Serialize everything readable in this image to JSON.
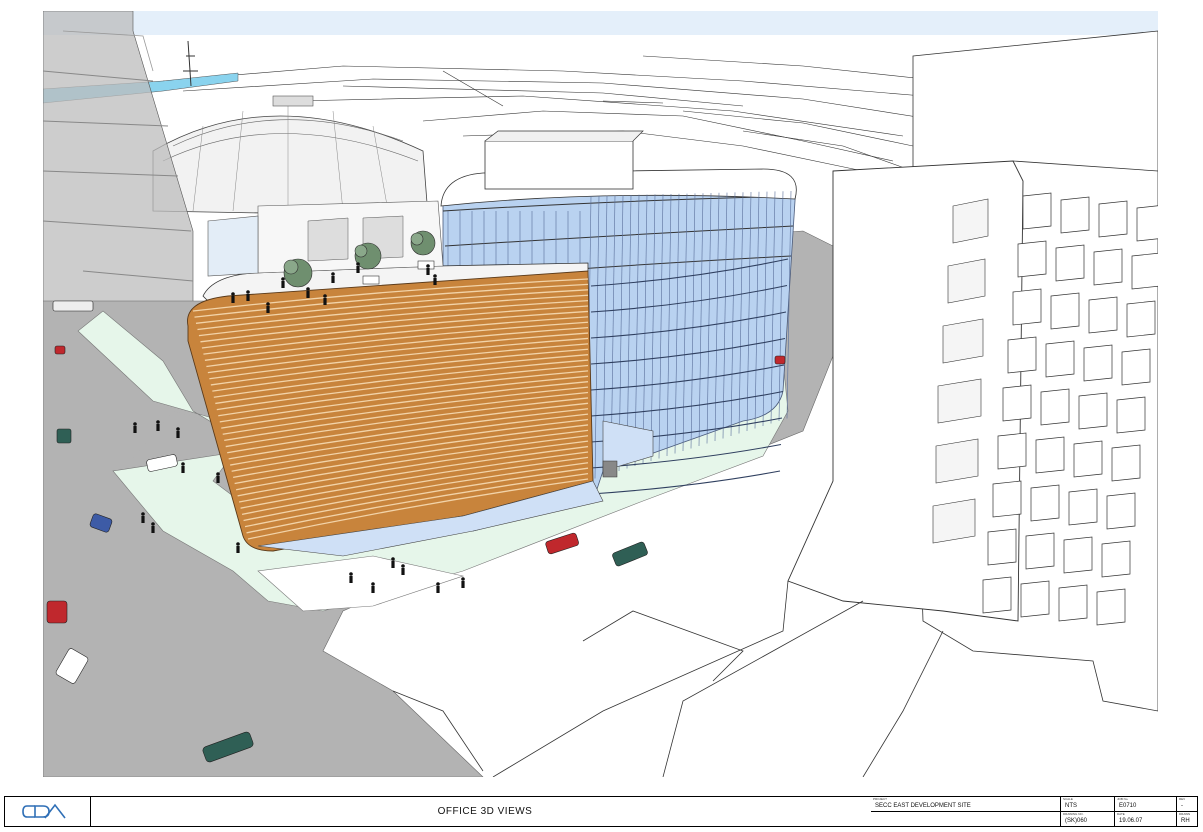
{
  "sheet": {
    "logo_text": "CDA",
    "title": "OFFICE 3D VIEWS"
  },
  "titleblock": {
    "project_label": "PROJECT",
    "project": "SECC EAST DEVELOPMENT SITE",
    "scale_label": "SCALE",
    "scale": "NTS",
    "drawing_no_label": "DRAWING NO.",
    "drawing_no": "(SK)060",
    "job_label": "JOB No.",
    "job": "E0710",
    "date_label": "DATE",
    "date": "19.06.07",
    "rev_label": "REV",
    "rev": "-",
    "drawn_label": "DRAWN",
    "drawn": "RH"
  },
  "colors": {
    "glass": "#b9d2f0",
    "louvre": "#c8843c",
    "road": "#b3b3b3",
    "landscape": "#e6f6ea",
    "water": "#8ad3ee",
    "car_red": "#c0282d",
    "car_green": "#2f5f55",
    "car_blue": "#3d5ba6"
  }
}
